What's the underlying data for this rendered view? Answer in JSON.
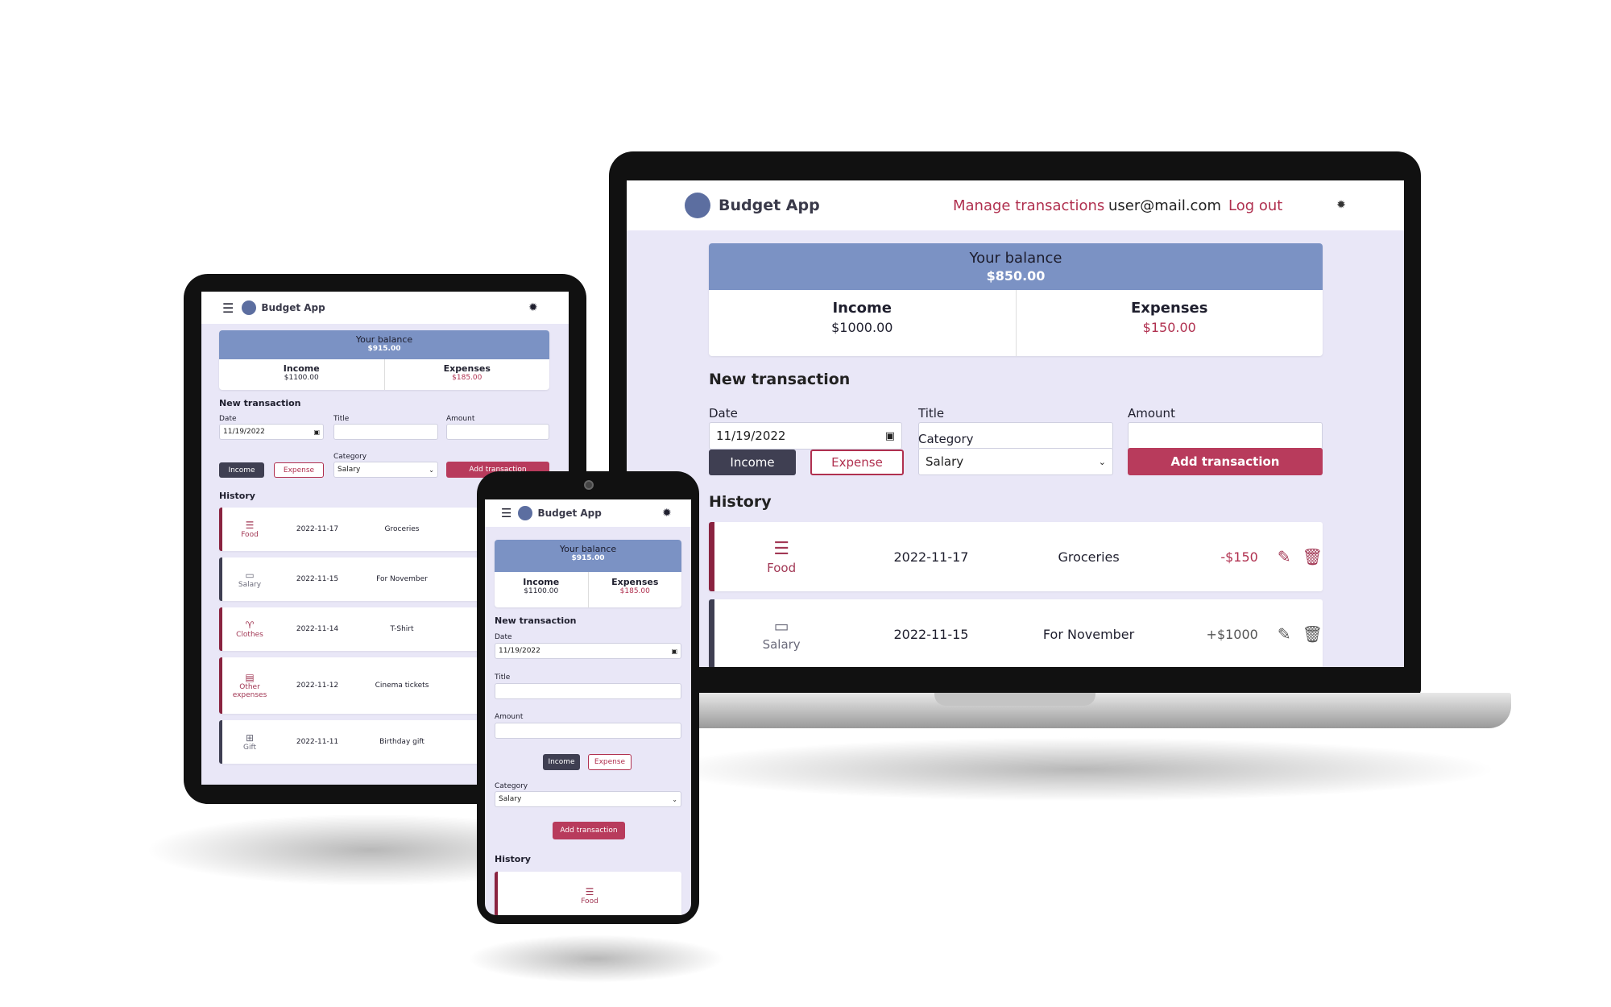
{
  "app": {
    "brand": "Budget App",
    "nav_manage": "Manage transactions",
    "user_email": "user@mail.com",
    "logout": "Log out"
  },
  "laptop": {
    "balance_label": "Your balance",
    "balance_value": "$850.00",
    "income_label": "Income",
    "income_value": "$1000.00",
    "expenses_label": "Expenses",
    "expenses_value": "$150.00",
    "new_transaction": "New transaction",
    "date_label": "Date",
    "date_value": "11/19/2022",
    "title_label": "Title",
    "amount_label": "Amount",
    "category_label": "Category",
    "category_value": "Salary",
    "income_btn": "Income",
    "expense_btn": "Expense",
    "add_btn": "Add transaction",
    "history": "History",
    "items": [
      {
        "category": "Food",
        "date": "2022-11-17",
        "title": "Groceries",
        "amount": "-$150",
        "type": "expense"
      },
      {
        "category": "Salary",
        "date": "2022-11-15",
        "title": "For November",
        "amount": "+$1000",
        "type": "income"
      }
    ]
  },
  "tablet": {
    "balance_label": "Your balance",
    "balance_value": "$915.00",
    "income_label": "Income",
    "income_value": "$1100.00",
    "expenses_label": "Expenses",
    "expenses_value": "$185.00",
    "new_transaction": "New transaction",
    "date_label": "Date",
    "date_value": "11/19/2022",
    "title_label": "Title",
    "amount_label": "Amount",
    "category_label": "Category",
    "category_value": "Salary",
    "income_btn": "Income",
    "expense_btn": "Expense",
    "add_btn": "Add transaction",
    "history": "History",
    "items": [
      {
        "category": "Food",
        "date": "2022-11-17",
        "title": "Groceries"
      },
      {
        "category": "Salary",
        "date": "2022-11-15",
        "title": "For November"
      },
      {
        "category": "Clothes",
        "date": "2022-11-14",
        "title": "T-Shirt"
      },
      {
        "category": "Other expenses",
        "date": "2022-11-12",
        "title": "Cinema tickets"
      },
      {
        "category": "Gift",
        "date": "2022-11-11",
        "title": "Birthday gift"
      }
    ]
  },
  "phone": {
    "balance_label": "Your balance",
    "balance_value": "$915.00",
    "income_label": "Income",
    "income_value": "$1100.00",
    "expenses_label": "Expenses",
    "expenses_value": "$185.00",
    "new_transaction": "New transaction",
    "date_label": "Date",
    "date_value": "11/19/2022",
    "title_label": "Title",
    "amount_label": "Amount",
    "income_btn": "Income",
    "expense_btn": "Expense",
    "category_label": "Category",
    "category_value": "Salary",
    "add_btn": "Add transaction",
    "history": "History",
    "first_item_category": "Food"
  },
  "colors": {
    "accent": "#b83b5c",
    "balance_header": "#7b92c4",
    "background": "#e9e7f7",
    "dark_button": "#3f3f52"
  }
}
